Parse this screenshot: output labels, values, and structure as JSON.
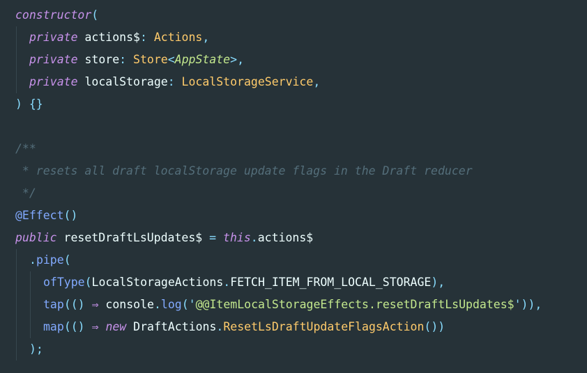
{
  "lines": [
    {
      "indent": 0,
      "guides": [],
      "tokens": [
        {
          "t": "constructor",
          "c": "fn"
        },
        {
          "t": "(",
          "c": "punc"
        }
      ]
    },
    {
      "indent": 1,
      "guides": [
        0
      ],
      "tokens": [
        {
          "t": "private",
          "c": "kw"
        },
        {
          "t": " actions$",
          "c": "var"
        },
        {
          "t": ":",
          "c": "punc"
        },
        {
          "t": " Actions",
          "c": "type"
        },
        {
          "t": ",",
          "c": "punc"
        }
      ]
    },
    {
      "indent": 1,
      "guides": [
        0
      ],
      "tokens": [
        {
          "t": "private",
          "c": "kw"
        },
        {
          "t": " store",
          "c": "var"
        },
        {
          "t": ":",
          "c": "punc"
        },
        {
          "t": " Store",
          "c": "type"
        },
        {
          "t": "<",
          "c": "punc"
        },
        {
          "t": "AppState",
          "c": "type-it"
        },
        {
          "t": ">",
          "c": "punc"
        },
        {
          "t": ",",
          "c": "punc"
        }
      ]
    },
    {
      "indent": 1,
      "guides": [
        0
      ],
      "tokens": [
        {
          "t": "private",
          "c": "kw"
        },
        {
          "t": " localStorage",
          "c": "var"
        },
        {
          "t": ":",
          "c": "punc"
        },
        {
          "t": " LocalStorageService",
          "c": "type"
        },
        {
          "t": ",",
          "c": "punc"
        }
      ]
    },
    {
      "indent": 0,
      "guides": [],
      "tokens": [
        {
          "t": ") {}",
          "c": "punc"
        }
      ]
    },
    {
      "indent": 0,
      "guides": [],
      "tokens": []
    },
    {
      "indent": 0,
      "guides": [],
      "tokens": [
        {
          "t": "/**",
          "c": "comment"
        }
      ]
    },
    {
      "indent": 0,
      "guides": [],
      "tokens": [
        {
          "t": " * resets all draft localStorage update flags in the Draft reducer",
          "c": "comment"
        }
      ]
    },
    {
      "indent": 0,
      "guides": [],
      "tokens": [
        {
          "t": " */",
          "c": "comment"
        }
      ]
    },
    {
      "indent": 0,
      "guides": [],
      "tokens": [
        {
          "t": "@Effect",
          "c": "dec"
        },
        {
          "t": "()",
          "c": "punc"
        }
      ]
    },
    {
      "indent": 0,
      "guides": [],
      "tokens": [
        {
          "t": "public",
          "c": "kw"
        },
        {
          "t": " resetDraftLsUpdates$ ",
          "c": "var"
        },
        {
          "t": "=",
          "c": "punc"
        },
        {
          "t": " ",
          "c": "plain"
        },
        {
          "t": "this",
          "c": "kw"
        },
        {
          "t": ".",
          "c": "punc"
        },
        {
          "t": "actions$",
          "c": "var"
        }
      ]
    },
    {
      "indent": 1,
      "guides": [
        0
      ],
      "tokens": [
        {
          "t": ".",
          "c": "punc"
        },
        {
          "t": "pipe",
          "c": "call"
        },
        {
          "t": "(",
          "c": "punc"
        }
      ]
    },
    {
      "indent": 2,
      "guides": [
        0,
        1
      ],
      "tokens": [
        {
          "t": "ofType",
          "c": "call"
        },
        {
          "t": "(",
          "c": "punc"
        },
        {
          "t": "LocalStorageActions",
          "c": "var"
        },
        {
          "t": ".",
          "c": "punc"
        },
        {
          "t": "FETCH_ITEM_FROM_LOCAL_STORAGE",
          "c": "var"
        },
        {
          "t": "),",
          "c": "punc"
        }
      ]
    },
    {
      "indent": 2,
      "guides": [
        0,
        1
      ],
      "tokens": [
        {
          "t": "tap",
          "c": "call"
        },
        {
          "t": "(() ",
          "c": "punc"
        },
        {
          "t": "⇒",
          "c": "kw"
        },
        {
          "t": " console",
          "c": "var"
        },
        {
          "t": ".",
          "c": "punc"
        },
        {
          "t": "log",
          "c": "call"
        },
        {
          "t": "('",
          "c": "punc"
        },
        {
          "t": "@@ItemLocalStorageEffects.resetDraftLsUpdates$",
          "c": "str"
        },
        {
          "t": "')),",
          "c": "punc"
        }
      ]
    },
    {
      "indent": 2,
      "guides": [
        0,
        1
      ],
      "tokens": [
        {
          "t": "map",
          "c": "call"
        },
        {
          "t": "(() ",
          "c": "punc"
        },
        {
          "t": "⇒",
          "c": "kw"
        },
        {
          "t": " ",
          "c": "plain"
        },
        {
          "t": "new",
          "c": "kw"
        },
        {
          "t": " DraftActions",
          "c": "var"
        },
        {
          "t": ".",
          "c": "punc"
        },
        {
          "t": "ResetLsDraftUpdateFlagsAction",
          "c": "type"
        },
        {
          "t": "())",
          "c": "punc"
        }
      ]
    },
    {
      "indent": 1,
      "guides": [
        0
      ],
      "tokens": [
        {
          "t": ");",
          "c": "punc"
        }
      ]
    }
  ]
}
